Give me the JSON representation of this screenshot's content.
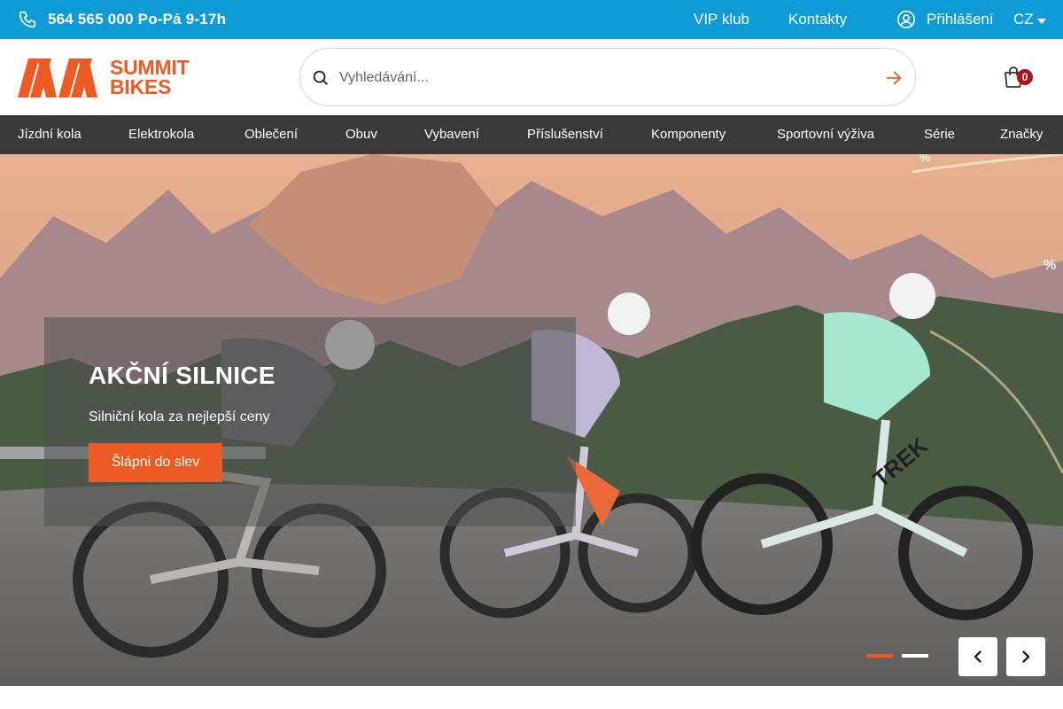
{
  "topbar": {
    "phone": "564 565 000 Po-Pá 9-17h",
    "links": [
      "VIP klub",
      "Kontakty"
    ],
    "login": "Přihlášení",
    "lang": "CZ"
  },
  "header": {
    "logo_line1": "SUMMIT",
    "logo_line2": "BIKES",
    "search_placeholder": "Vyhledávání...",
    "cart_count": "0"
  },
  "nav": {
    "items": [
      "Jízdní kola",
      "Elektrokola",
      "Oblečení",
      "Obuv",
      "Vybavení",
      "Příslušenství",
      "Komponenty",
      "Sportovní výživa",
      "Série",
      "Značky"
    ]
  },
  "hero": {
    "title": "AKČNÍ SILNICE",
    "subtitle": "Silniční kola za nejlepší ceny",
    "cta": "Šlápni do slev",
    "slides_total": 2,
    "active_slide": 1,
    "bike_brand_text": "TREK"
  },
  "colors": {
    "topbar": "#0e9bd6",
    "accent": "#ee5a24",
    "nav": "#3a3a3a",
    "badge": "#b3101b"
  },
  "icons": [
    "phone-icon",
    "user-circle-icon",
    "search-icon",
    "arrow-right-icon",
    "shopping-bag-icon",
    "chevron-left-icon",
    "chevron-right-icon"
  ]
}
